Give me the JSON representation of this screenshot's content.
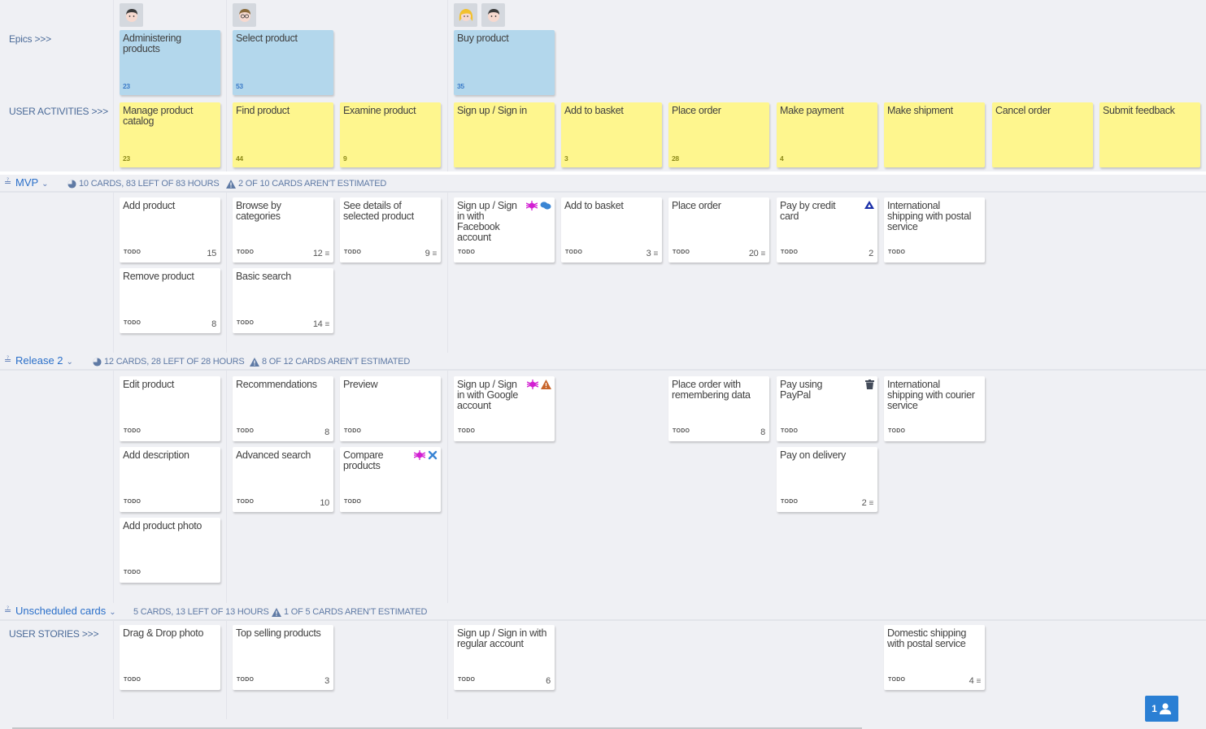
{
  "row_labels": {
    "epics": "Epics >>>",
    "activities": "USER ACTIVITIES >>>",
    "stories": "USER STORIES >>>"
  },
  "avatars": [
    {
      "name": "male-dark-hair-avatar"
    },
    {
      "name": "male-glasses-avatar"
    },
    {
      "name": "female-blonde-avatar"
    },
    {
      "name": "male-dark-hair-avatar"
    }
  ],
  "epics": [
    {
      "title": "Administering products",
      "count": "23"
    },
    {
      "title": "Select product",
      "count": "53"
    },
    {
      "title": "Buy product",
      "count": "35"
    }
  ],
  "activities": [
    {
      "title": "Manage product catalog",
      "count": "23"
    },
    {
      "title": "Find product",
      "count": "44"
    },
    {
      "title": "Examine product",
      "count": "9"
    },
    {
      "title": "Sign up / Sign in",
      "count": ""
    },
    {
      "title": "Add to basket",
      "count": "3"
    },
    {
      "title": "Place order",
      "count": "28"
    },
    {
      "title": "Make payment",
      "count": "4"
    },
    {
      "title": "Make shipment",
      "count": ""
    },
    {
      "title": "Cancel order",
      "count": ""
    },
    {
      "title": "Submit feedback",
      "count": ""
    }
  ],
  "releases": [
    {
      "name": "MVP",
      "stats": "10 CARDS, 83 LEFT OF 83 HOURS",
      "warning": "2 OF 10 CARDS AREN'T ESTIMATED",
      "cards": [
        {
          "title": "Add product",
          "status": "TODO",
          "estimate": "15",
          "has_desc": false
        },
        {
          "title": "Browse by categories",
          "status": "TODO",
          "estimate": "12",
          "has_desc": true
        },
        {
          "title": "See details of selected product",
          "status": "TODO",
          "estimate": "9",
          "has_desc": true
        },
        {
          "title": "Sign up / Sign in with Facebook account",
          "status": "TODO",
          "estimate": "",
          "has_desc": false,
          "icons": [
            "bug-icon",
            "comments-icon"
          ]
        },
        {
          "title": "Add to basket",
          "status": "TODO",
          "estimate": "3",
          "has_desc": true
        },
        {
          "title": "Place order",
          "status": "TODO",
          "estimate": "20",
          "has_desc": true
        },
        {
          "title": "Pay by credit card",
          "status": "TODO",
          "estimate": "2",
          "has_desc": false,
          "icons": [
            "drive-icon"
          ]
        },
        {
          "title": "International shipping with postal service",
          "status": "TODO",
          "estimate": "",
          "has_desc": false
        },
        {
          "title": "Remove product",
          "status": "TODO",
          "estimate": "8",
          "has_desc": false
        },
        {
          "title": "Basic search",
          "status": "TODO",
          "estimate": "14",
          "has_desc": true
        }
      ]
    },
    {
      "name": "Release 2",
      "stats": "12 CARDS, 28 LEFT OF 28 HOURS",
      "warning": "8 OF 12 CARDS AREN'T ESTIMATED",
      "cards": [
        {
          "title": "Edit product",
          "status": "TODO",
          "estimate": "",
          "has_desc": false
        },
        {
          "title": "Recommendations",
          "status": "TODO",
          "estimate": "8",
          "has_desc": false
        },
        {
          "title": "Preview",
          "status": "TODO",
          "estimate": "",
          "has_desc": false
        },
        {
          "title": "Sign up / Sign in with Google account",
          "status": "TODO",
          "estimate": "",
          "has_desc": false,
          "icons": [
            "bug-icon",
            "warning-icon"
          ]
        },
        {
          "title": "Place order with remembering data",
          "status": "TODO",
          "estimate": "8",
          "has_desc": false
        },
        {
          "title": "Pay using PayPal",
          "status": "TODO",
          "estimate": "",
          "has_desc": false,
          "icons": [
            "trash-icon"
          ]
        },
        {
          "title": "International shipping with courier service",
          "status": "TODO",
          "estimate": "",
          "has_desc": false
        },
        {
          "title": "Add description",
          "status": "TODO",
          "estimate": "",
          "has_desc": false
        },
        {
          "title": "Advanced search",
          "status": "TODO",
          "estimate": "10",
          "has_desc": false
        },
        {
          "title": "Compare products",
          "status": "TODO",
          "estimate": "",
          "has_desc": false,
          "icons": [
            "bug-icon",
            "tools-icon"
          ]
        },
        {
          "title": "Pay on delivery",
          "status": "TODO",
          "estimate": "2",
          "has_desc": true
        },
        {
          "title": "Add product photo",
          "status": "TODO",
          "estimate": "",
          "has_desc": false
        }
      ]
    },
    {
      "name": "Unscheduled cards",
      "stats": "5 CARDS, 13 LEFT OF 13 HOURS",
      "warning": "1 OF 5 CARDS AREN'T ESTIMATED",
      "cards": [
        {
          "title": "Drag & Drop photo",
          "status": "TODO",
          "estimate": "",
          "has_desc": false
        },
        {
          "title": "Top selling products",
          "status": "TODO",
          "estimate": "3",
          "has_desc": false
        },
        {
          "title": "Sign up / Sign in with regular account",
          "status": "TODO",
          "estimate": "6",
          "has_desc": false
        },
        {
          "title": "Domestic shipping with postal service",
          "status": "TODO",
          "estimate": "4",
          "has_desc": true
        }
      ]
    }
  ],
  "users_button": {
    "count": "1"
  },
  "colors": {
    "epic": "#b3d7ec",
    "activity": "#fef68e",
    "story": "#ffffff",
    "accent": "#2a7fd4",
    "bug": "#d21fd2",
    "warning": "#c8642a"
  }
}
